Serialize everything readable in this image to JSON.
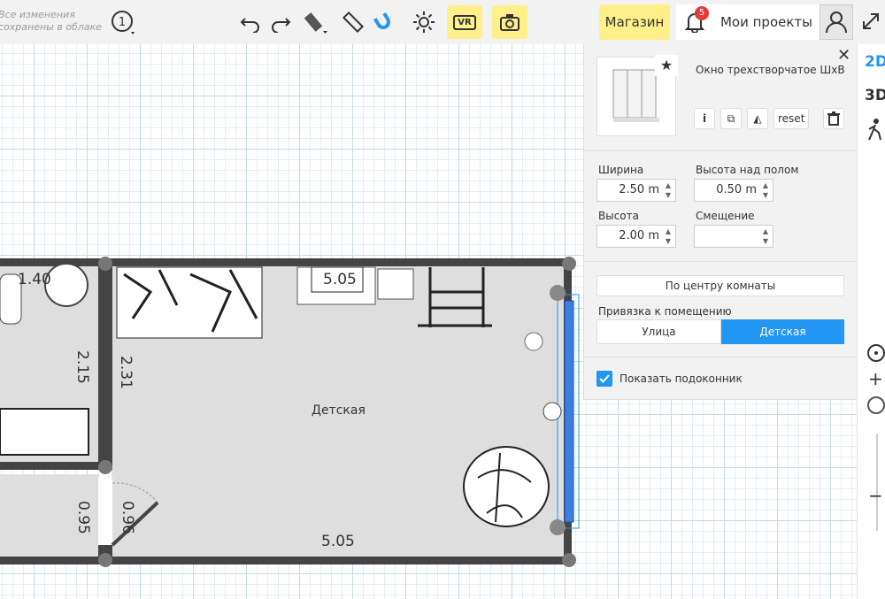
{
  "topbar": {
    "save_status_line1": "Все изменения",
    "save_status_line2": "сохранены в облаке",
    "level_number": "1",
    "vr_label": "VR",
    "shop_label": "Магазин",
    "notifications_count": "5",
    "projects_label": "Мои проекты"
  },
  "rail": {
    "view_2d": "2D",
    "view_3d": "3D"
  },
  "panel": {
    "item_name": "Окно трехстворчатое ШхВ",
    "reset_label": "reset",
    "width_label": "Ширина",
    "width_value": "2.50 m",
    "height_above_floor_label": "Высота над полом",
    "height_above_floor_value": "0.50 m",
    "height_label": "Высота",
    "height_value": "2.00 m",
    "offset_label": "Смещение",
    "offset_value": "",
    "center_button": "По центру комнаты",
    "binding_label": "Привязка к помещению",
    "binding_options": [
      "Улица",
      "Детская"
    ],
    "binding_selected": "Детская",
    "show_sill_label": "Показать подоконник",
    "show_sill_checked": true
  },
  "plan": {
    "room_name": "Детская",
    "dim_top": "5.05",
    "dim_bottom": "5.05",
    "dim_left_room": "2.31",
    "dim_adjacent": "2.15",
    "dim_left_top": "1.40",
    "dim_door_a": "0.95",
    "dim_door_b": "0.96"
  },
  "colors": {
    "accent": "#2196f3",
    "highlight": "#fff08a",
    "wall": "#444444",
    "badge": "#e53935"
  }
}
